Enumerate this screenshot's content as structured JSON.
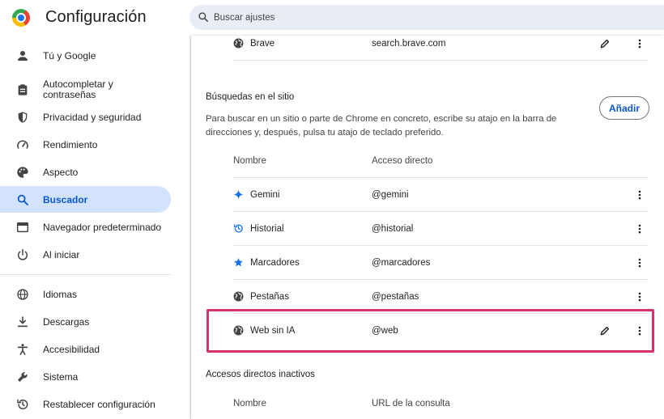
{
  "header": {
    "title": "Configuración",
    "search_placeholder": "Buscar ajustes"
  },
  "sidebar": {
    "items": [
      {
        "label": "Tú y Google",
        "icon": "person-icon"
      },
      {
        "label": "Autocompletar y contraseñas",
        "icon": "clipboard-icon"
      },
      {
        "label": "Privacidad y seguridad",
        "icon": "shield-icon"
      },
      {
        "label": "Rendimiento",
        "icon": "speedometer-icon"
      },
      {
        "label": "Aspecto",
        "icon": "palette-icon"
      },
      {
        "label": "Buscador",
        "icon": "search-icon",
        "active": true
      },
      {
        "label": "Navegador predeterminado",
        "icon": "browser-window-icon"
      },
      {
        "label": "Al iniciar",
        "icon": "power-icon"
      },
      {
        "label": "Idiomas",
        "icon": "globe-icon"
      },
      {
        "label": "Descargas",
        "icon": "download-icon"
      },
      {
        "label": "Accesibilidad",
        "icon": "accessibility-icon"
      },
      {
        "label": "Sistema",
        "icon": "wrench-icon"
      },
      {
        "label": "Restablecer configuración",
        "icon": "history-icon"
      }
    ]
  },
  "main": {
    "top_row": {
      "name": "Brave",
      "shortcut": "search.brave.com"
    },
    "site_search": {
      "title": "Búsquedas en el sitio",
      "description": "Para buscar en un sitio o parte de Chrome en concreto, escribe su atajo en la barra de direcciones y, después, pulsa tu atajo de teclado preferido.",
      "add_label": "Añadir",
      "columns": {
        "name": "Nombre",
        "shortcut": "Acceso directo"
      },
      "rows": [
        {
          "name": "Gemini",
          "shortcut": "@gemini",
          "icon": "sparkle-icon"
        },
        {
          "name": "Historial",
          "shortcut": "@historial",
          "icon": "history-icon"
        },
        {
          "name": "Marcadores",
          "shortcut": "@marcadores",
          "icon": "star-icon"
        },
        {
          "name": "Pestañas",
          "shortcut": "@pestañas",
          "icon": "globe-icon"
        },
        {
          "name": "Web sin IA",
          "shortcut": "@web",
          "icon": "globe-icon",
          "highlighted": true
        }
      ]
    },
    "inactive": {
      "title": "Accesos directos inactivos",
      "columns": {
        "name": "Nombre",
        "url": "URL de la consulta"
      }
    }
  },
  "colors": {
    "accent": "#0b57d0",
    "active_nav_bg": "#d3e3fd",
    "highlight_border": "#d6336c",
    "search_bg": "#e9eef6"
  }
}
